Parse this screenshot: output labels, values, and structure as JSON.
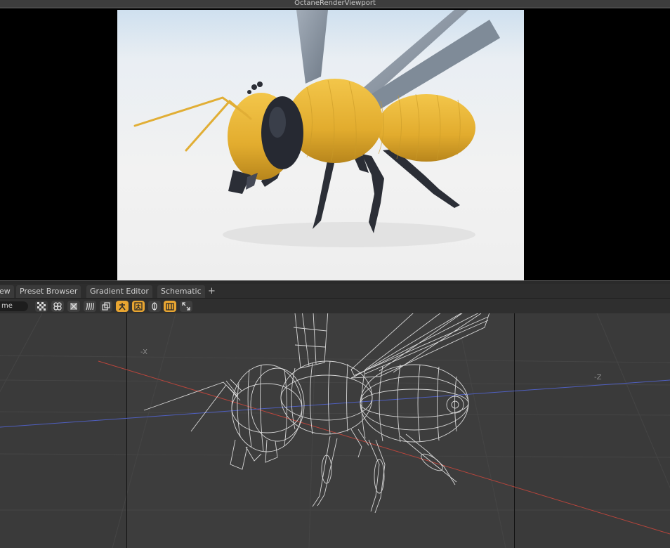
{
  "octane": {
    "title": "OctaneRenderViewport"
  },
  "tabs": [
    {
      "label": "ew"
    },
    {
      "label": "Preset Browser"
    },
    {
      "label": "Gradient Editor"
    },
    {
      "label": "Schematic"
    }
  ],
  "tab_add": "+",
  "toolbar": {
    "mode_dropdown": "me",
    "buttons": [
      {
        "icon": "checker-icon",
        "active": false
      },
      {
        "icon": "shaded-wire-icon",
        "active": false
      },
      {
        "icon": "solid-icon",
        "active": false
      },
      {
        "icon": "hair-icon",
        "active": false
      },
      {
        "icon": "layers-icon",
        "active": false
      },
      {
        "icon": "figure-icon",
        "active": true
      },
      {
        "icon": "figure-frame-icon",
        "active": true
      },
      {
        "icon": "cylinder-icon",
        "active": false
      },
      {
        "icon": "shaded-box-icon",
        "active": true
      },
      {
        "icon": "expand-icon",
        "active": false
      }
    ]
  },
  "viewport": {
    "axis_x_label": "-X",
    "axis_z_label": "-Z"
  },
  "colors": {
    "accent": "#e8a531",
    "bee_yellow": "#e9b538",
    "bee_dark": "#2b2e36",
    "wing": "#8e99a6",
    "wire": "#e8e8e8",
    "x_axis": "#b8453c",
    "z_axis": "#4f5fc0"
  }
}
